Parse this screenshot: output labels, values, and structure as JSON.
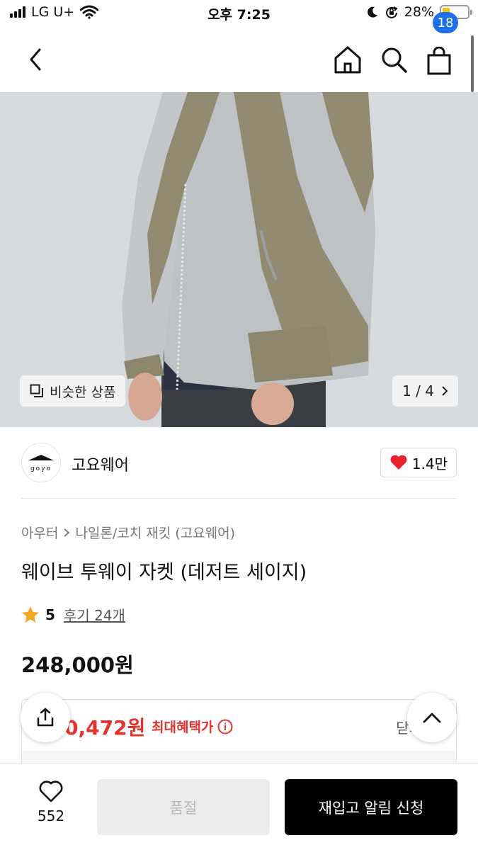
{
  "status_bar": {
    "carrier": "LG U+",
    "time": "오후 7:25",
    "battery_percent": "28%",
    "battery_level": 0.28
  },
  "nav": {
    "cart_count": "18",
    "icons": [
      "back-arrow-icon",
      "home-icon",
      "search-icon",
      "shopping-bag-icon"
    ]
  },
  "gallery": {
    "similar_label": "비슷한 상품",
    "page_indicator": "1 / 4"
  },
  "brand": {
    "logo_text": "goyo",
    "name": "고요웨어",
    "likes": "1.4만"
  },
  "product": {
    "breadcrumb_category": "아우터",
    "breadcrumb_sub": "나일론/코치 재킷 (고요웨어)",
    "title": "웨이브 투웨이 자켓 (데저트 세이지)",
    "rating": "5",
    "review_text": "후기 24개",
    "price": "248,000원"
  },
  "benefit": {
    "partial_price": "0,472원",
    "label": "최대혜택가",
    "close_label": "닫기"
  },
  "bottom_bar": {
    "wish_count": "552",
    "soldout_label": "품절",
    "restock_label": "재입고 알림 신청"
  },
  "colors": {
    "accent_blue": "#1f6fe8",
    "benefit_red": "#e4322d",
    "heart_red": "#e8212e",
    "star_orange": "#f5a623",
    "jacket_grey": "#b9bcbf",
    "jacket_khaki": "#8f8a70"
  }
}
